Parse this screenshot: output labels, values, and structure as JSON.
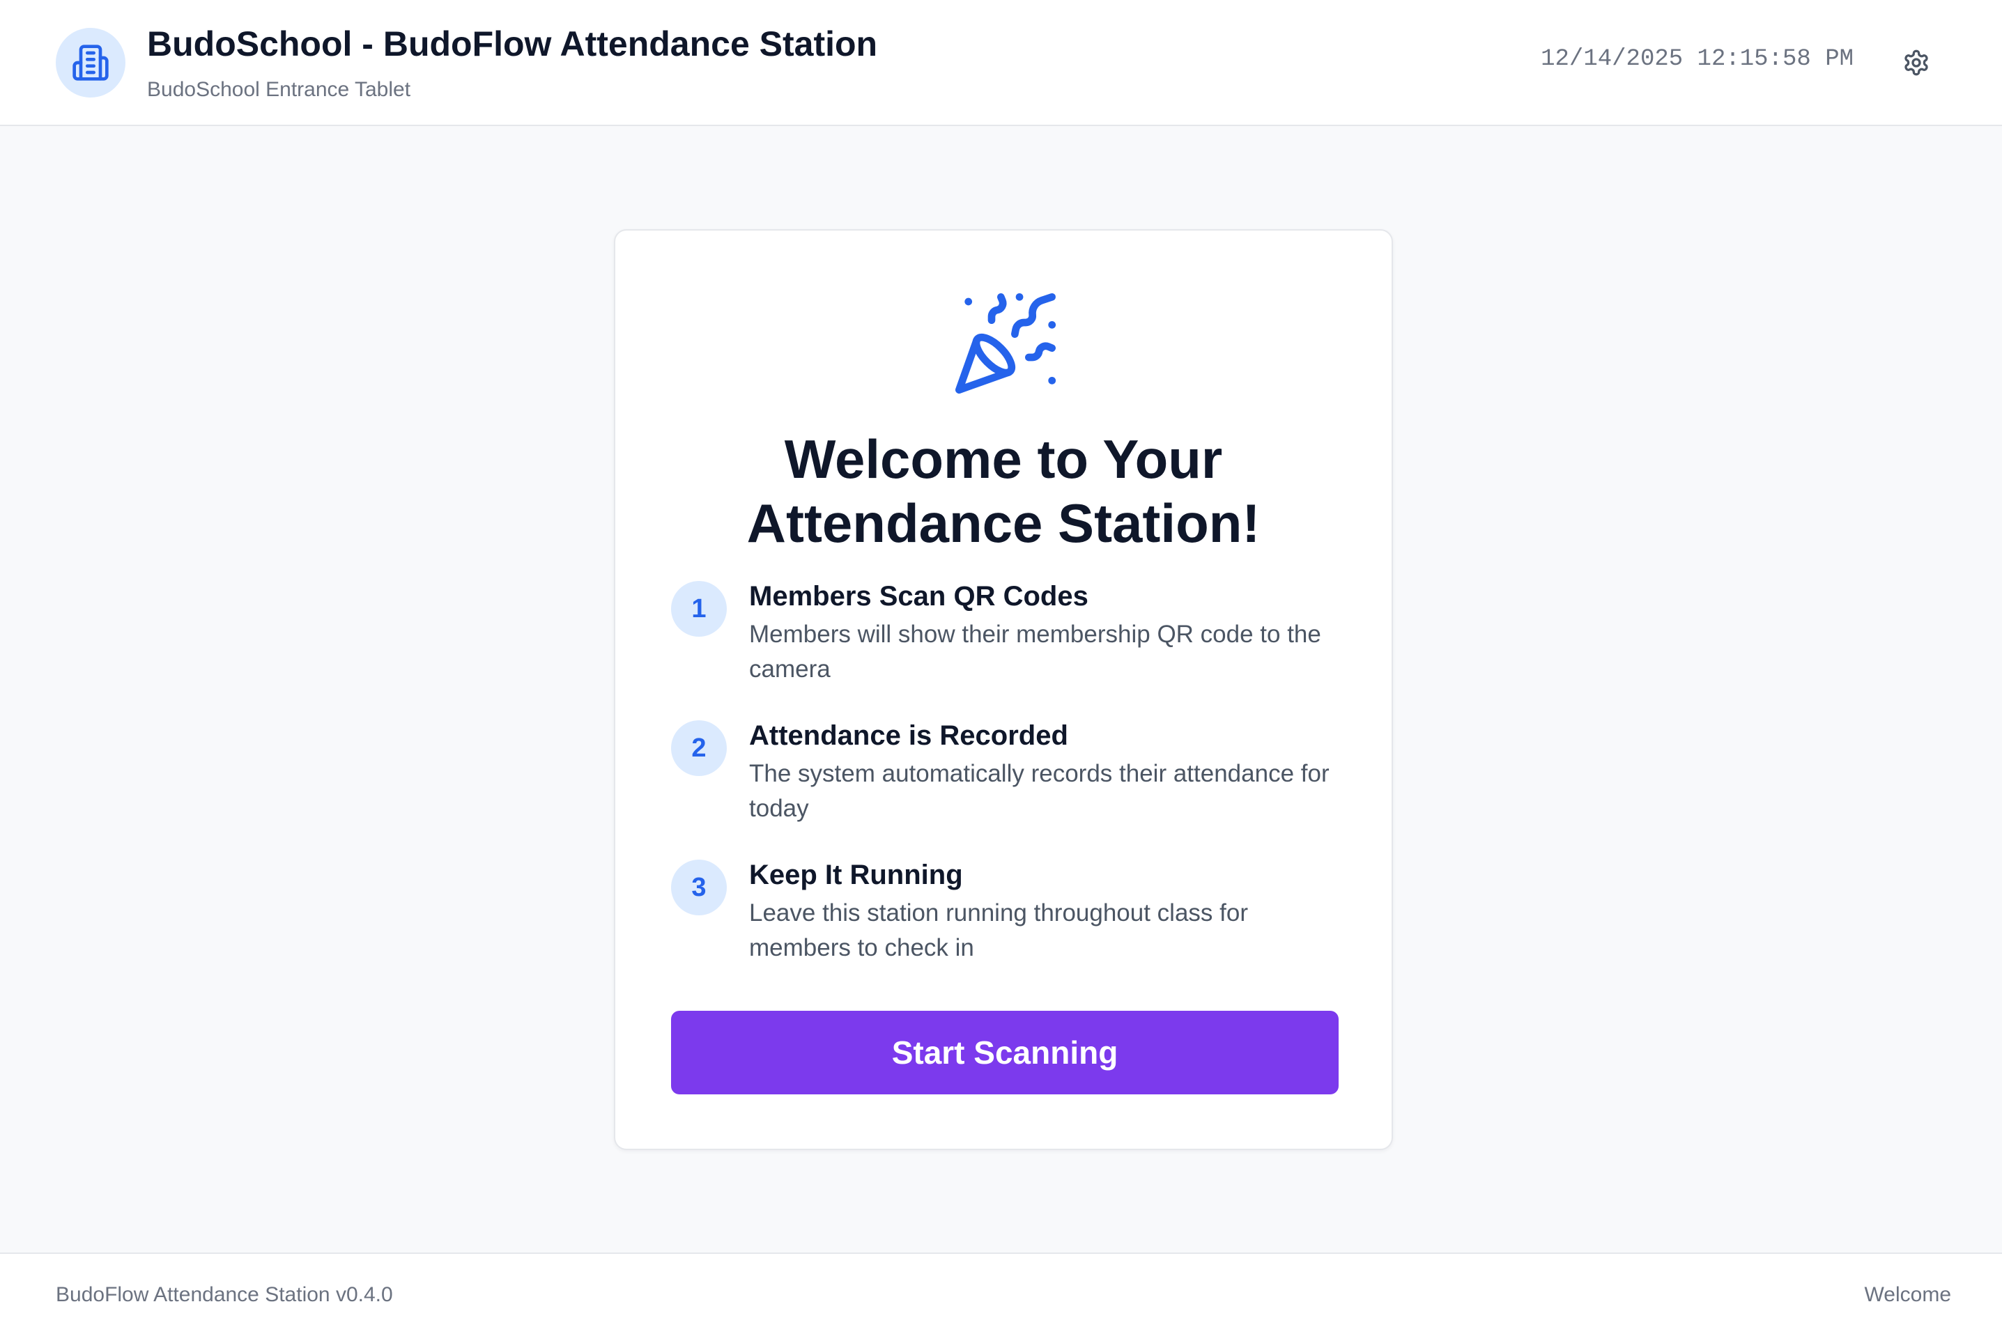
{
  "header": {
    "title": "BudoSchool - BudoFlow Attendance Station",
    "subtitle": "BudoSchool Entrance Tablet",
    "datetime": "12/14/2025 12:15:58 PM",
    "logo_icon": "building-icon",
    "settings_icon": "gear-icon"
  },
  "welcome": {
    "icon": "party-popper-icon",
    "title_line1": "Welcome to Your",
    "title_line2": "Attendance Station!",
    "steps": [
      {
        "number": "1",
        "title": "Members Scan QR Codes",
        "description": "Members will show their membership QR code to the camera"
      },
      {
        "number": "2",
        "title": "Attendance is Recorded",
        "description": "The system automatically records their attendance for today"
      },
      {
        "number": "3",
        "title": "Keep It Running",
        "description": "Leave this station running throughout class for members to check in"
      }
    ],
    "start_button_label": "Start Scanning"
  },
  "footer": {
    "version": "BudoFlow Attendance Station v0.4.0",
    "status": "Welcome"
  },
  "colors": {
    "accent": "#2563eb",
    "button": "#7c3aed",
    "icon_background": "#dbeafe"
  }
}
